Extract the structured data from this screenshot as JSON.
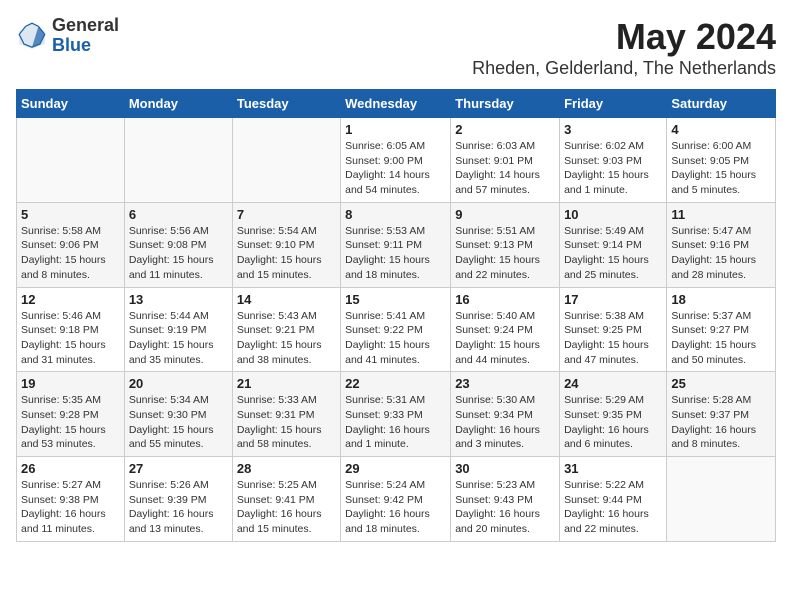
{
  "header": {
    "logo_general": "General",
    "logo_blue": "Blue",
    "month_year": "May 2024",
    "location": "Rheden, Gelderland, The Netherlands"
  },
  "days_of_week": [
    "Sunday",
    "Monday",
    "Tuesday",
    "Wednesday",
    "Thursday",
    "Friday",
    "Saturday"
  ],
  "weeks": [
    [
      {
        "day": "",
        "info": ""
      },
      {
        "day": "",
        "info": ""
      },
      {
        "day": "",
        "info": ""
      },
      {
        "day": "1",
        "info": "Sunrise: 6:05 AM\nSunset: 9:00 PM\nDaylight: 14 hours\nand 54 minutes."
      },
      {
        "day": "2",
        "info": "Sunrise: 6:03 AM\nSunset: 9:01 PM\nDaylight: 14 hours\nand 57 minutes."
      },
      {
        "day": "3",
        "info": "Sunrise: 6:02 AM\nSunset: 9:03 PM\nDaylight: 15 hours\nand 1 minute."
      },
      {
        "day": "4",
        "info": "Sunrise: 6:00 AM\nSunset: 9:05 PM\nDaylight: 15 hours\nand 5 minutes."
      }
    ],
    [
      {
        "day": "5",
        "info": "Sunrise: 5:58 AM\nSunset: 9:06 PM\nDaylight: 15 hours\nand 8 minutes."
      },
      {
        "day": "6",
        "info": "Sunrise: 5:56 AM\nSunset: 9:08 PM\nDaylight: 15 hours\nand 11 minutes."
      },
      {
        "day": "7",
        "info": "Sunrise: 5:54 AM\nSunset: 9:10 PM\nDaylight: 15 hours\nand 15 minutes."
      },
      {
        "day": "8",
        "info": "Sunrise: 5:53 AM\nSunset: 9:11 PM\nDaylight: 15 hours\nand 18 minutes."
      },
      {
        "day": "9",
        "info": "Sunrise: 5:51 AM\nSunset: 9:13 PM\nDaylight: 15 hours\nand 22 minutes."
      },
      {
        "day": "10",
        "info": "Sunrise: 5:49 AM\nSunset: 9:14 PM\nDaylight: 15 hours\nand 25 minutes."
      },
      {
        "day": "11",
        "info": "Sunrise: 5:47 AM\nSunset: 9:16 PM\nDaylight: 15 hours\nand 28 minutes."
      }
    ],
    [
      {
        "day": "12",
        "info": "Sunrise: 5:46 AM\nSunset: 9:18 PM\nDaylight: 15 hours\nand 31 minutes."
      },
      {
        "day": "13",
        "info": "Sunrise: 5:44 AM\nSunset: 9:19 PM\nDaylight: 15 hours\nand 35 minutes."
      },
      {
        "day": "14",
        "info": "Sunrise: 5:43 AM\nSunset: 9:21 PM\nDaylight: 15 hours\nand 38 minutes."
      },
      {
        "day": "15",
        "info": "Sunrise: 5:41 AM\nSunset: 9:22 PM\nDaylight: 15 hours\nand 41 minutes."
      },
      {
        "day": "16",
        "info": "Sunrise: 5:40 AM\nSunset: 9:24 PM\nDaylight: 15 hours\nand 44 minutes."
      },
      {
        "day": "17",
        "info": "Sunrise: 5:38 AM\nSunset: 9:25 PM\nDaylight: 15 hours\nand 47 minutes."
      },
      {
        "day": "18",
        "info": "Sunrise: 5:37 AM\nSunset: 9:27 PM\nDaylight: 15 hours\nand 50 minutes."
      }
    ],
    [
      {
        "day": "19",
        "info": "Sunrise: 5:35 AM\nSunset: 9:28 PM\nDaylight: 15 hours\nand 53 minutes."
      },
      {
        "day": "20",
        "info": "Sunrise: 5:34 AM\nSunset: 9:30 PM\nDaylight: 15 hours\nand 55 minutes."
      },
      {
        "day": "21",
        "info": "Sunrise: 5:33 AM\nSunset: 9:31 PM\nDaylight: 15 hours\nand 58 minutes."
      },
      {
        "day": "22",
        "info": "Sunrise: 5:31 AM\nSunset: 9:33 PM\nDaylight: 16 hours\nand 1 minute."
      },
      {
        "day": "23",
        "info": "Sunrise: 5:30 AM\nSunset: 9:34 PM\nDaylight: 16 hours\nand 3 minutes."
      },
      {
        "day": "24",
        "info": "Sunrise: 5:29 AM\nSunset: 9:35 PM\nDaylight: 16 hours\nand 6 minutes."
      },
      {
        "day": "25",
        "info": "Sunrise: 5:28 AM\nSunset: 9:37 PM\nDaylight: 16 hours\nand 8 minutes."
      }
    ],
    [
      {
        "day": "26",
        "info": "Sunrise: 5:27 AM\nSunset: 9:38 PM\nDaylight: 16 hours\nand 11 minutes."
      },
      {
        "day": "27",
        "info": "Sunrise: 5:26 AM\nSunset: 9:39 PM\nDaylight: 16 hours\nand 13 minutes."
      },
      {
        "day": "28",
        "info": "Sunrise: 5:25 AM\nSunset: 9:41 PM\nDaylight: 16 hours\nand 15 minutes."
      },
      {
        "day": "29",
        "info": "Sunrise: 5:24 AM\nSunset: 9:42 PM\nDaylight: 16 hours\nand 18 minutes."
      },
      {
        "day": "30",
        "info": "Sunrise: 5:23 AM\nSunset: 9:43 PM\nDaylight: 16 hours\nand 20 minutes."
      },
      {
        "day": "31",
        "info": "Sunrise: 5:22 AM\nSunset: 9:44 PM\nDaylight: 16 hours\nand 22 minutes."
      },
      {
        "day": "",
        "info": ""
      }
    ]
  ]
}
